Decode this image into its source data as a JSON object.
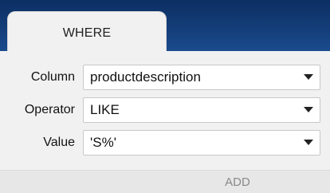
{
  "tabs": [
    {
      "label": "WHERE"
    }
  ],
  "filter": {
    "column": {
      "label": "Column",
      "value": "productdescription"
    },
    "operator": {
      "label": "Operator",
      "value": "LIKE"
    },
    "value": {
      "label": "Value",
      "value": "'S%'"
    }
  },
  "footer": {
    "add_label": "ADD"
  },
  "colors": {
    "tabstrip_bg": "#153f7c",
    "panel_bg": "#f1f1f1",
    "disabled_text": "#8a8a8a"
  },
  "icons": {
    "dropdown": "chevron-down-icon"
  }
}
